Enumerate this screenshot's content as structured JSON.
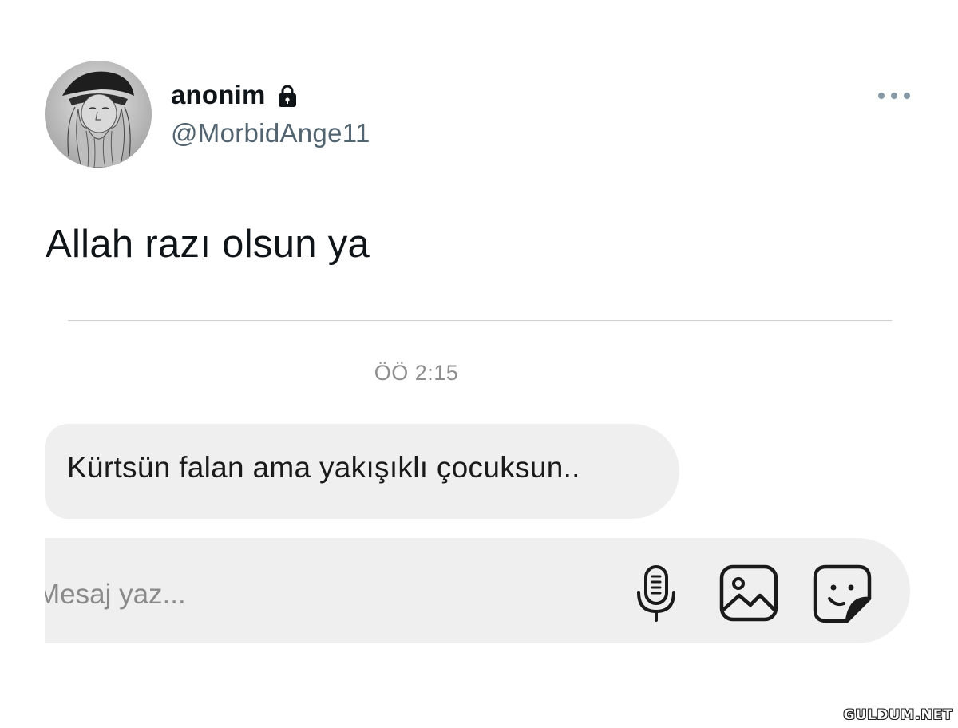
{
  "tweet": {
    "display_name": "anonim",
    "handle": "@MorbidAnge11",
    "text": "Allah razı olsun ya",
    "protected_icon": "lock-icon",
    "more_icon": "more-horizontal-icon"
  },
  "chat": {
    "timestamp": "ÖÖ 2:15",
    "message": "Kürtsün falan ama yakışıklı çocuksun..",
    "composer_placeholder": "Mesaj yaz...",
    "composer_value": "",
    "icons": [
      "microphone-icon",
      "image-icon",
      "sticker-icon"
    ]
  },
  "watermark": "GULDUM.NET",
  "colors": {
    "text": "#0f1419",
    "secondary": "#536471",
    "bubble": "#efefef",
    "timestamp": "#8e8e8e"
  }
}
